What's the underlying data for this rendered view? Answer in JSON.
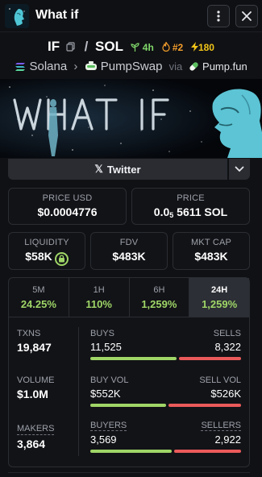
{
  "header": {
    "title": "What if"
  },
  "pair": {
    "base": "IF",
    "quote": "SOL",
    "separator": "/",
    "age": "4h",
    "rank": "#2",
    "boosts": "180"
  },
  "dex": {
    "chain": "Solana",
    "dex_name": "PumpSwap",
    "via_label": "via",
    "launchpad": "Pump.fun"
  },
  "banner": {
    "text": "WHAT IF"
  },
  "socials": {
    "twitter_label": "Twitter"
  },
  "stats": {
    "price_usd": {
      "label": "PRICE USD",
      "value": "$0.0004776"
    },
    "price_sol": {
      "label": "PRICE",
      "prefix": "0.0",
      "zeros": "5",
      "digits": "5611",
      "unit": "SOL"
    },
    "liquidity": {
      "label": "LIQUIDITY",
      "value": "$58K"
    },
    "fdv": {
      "label": "FDV",
      "value": "$483K"
    },
    "mkt_cap": {
      "label": "MKT CAP",
      "value": "$483K"
    }
  },
  "timeframes": [
    {
      "label": "5M",
      "change": "24.25%"
    },
    {
      "label": "1H",
      "change": "110%"
    },
    {
      "label": "6H",
      "change": "1,259%"
    },
    {
      "label": "24H",
      "change": "1,259%",
      "active": true
    }
  ],
  "txns": {
    "txns": {
      "label": "TXNS",
      "value": "19,847"
    },
    "volume": {
      "label": "VOLUME",
      "value": "$1.0M"
    },
    "makers": {
      "label": "MAKERS",
      "value": "3,864"
    },
    "buys": {
      "label": "BUYS",
      "value": "11,525"
    },
    "sells": {
      "label": "SELLS",
      "value": "8,322"
    },
    "buy_vol": {
      "label": "BUY VOL",
      "value": "$552K"
    },
    "sell_vol": {
      "label": "SELL VOL",
      "value": "$526K"
    },
    "buyers": {
      "label": "BUYERS",
      "value": "3,569"
    },
    "sellers": {
      "label": "SELLERS",
      "value": "2,922"
    },
    "ratios": {
      "buys": 0.58,
      "buy_vol": 0.51,
      "buyers": 0.55
    }
  },
  "colors": {
    "positive": "#9fd667",
    "negative": "#ea5a5a",
    "age": "#7fd66a",
    "rank": "#f59f2c",
    "boost": "#f0c419"
  }
}
